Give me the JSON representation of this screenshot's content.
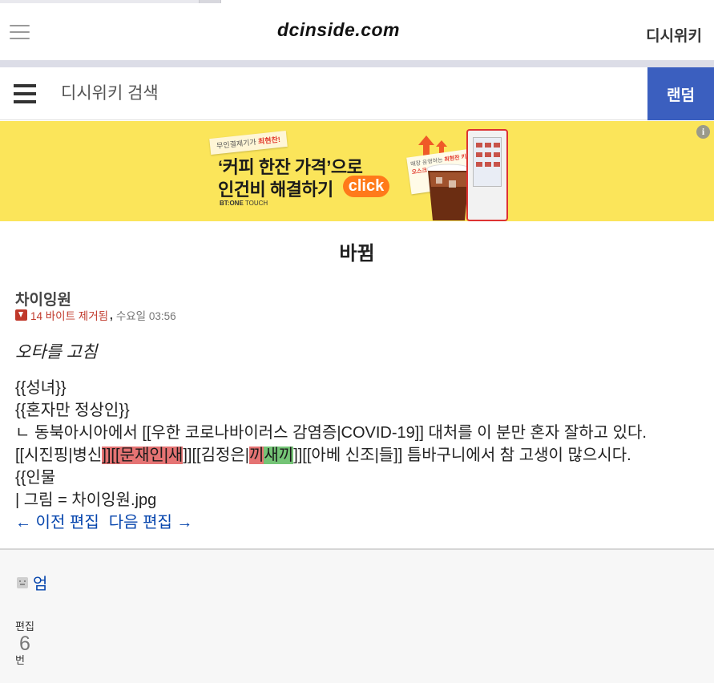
{
  "header": {
    "logo": "dcinside.com",
    "site_link": "디시위키"
  },
  "search": {
    "placeholder": "디시위키 검색",
    "random_label": "랜덤"
  },
  "ad": {
    "tag_prefix": "무인결제기가 ",
    "tag_highlight": "최현찬!",
    "line1": "‘커피 한잔 가격’으로",
    "line2": "인건비 해결하기",
    "click_label": "click",
    "brand_bold": "BT:ONE",
    "brand_rest": " TOUCH",
    "note_text": "매장 운영하는 ",
    "note_highlight": "최현찬 키오스크",
    "info_icon": "i"
  },
  "page": {
    "title": "바뀜"
  },
  "revision": {
    "author": "차이잉원",
    "bytes_removed": "14 바이트 제거됨",
    "comma": ",",
    "timestamp": "수요일 03:56",
    "summary": "오타를 고침"
  },
  "wikitext": {
    "line1": "{{성녀}}",
    "line2": "{{혼자만 정상인}}",
    "line3": "ㄴ 동북아시아에서 [[우한 코로나바이러스 감염증|COVID-19]] 대처를 이 분만 혼자 잘하고 있다.",
    "line4_a": "[[시진핑|병신",
    "line4_del1": "]][[문재인|새",
    "line4_b": "]][[김정은|",
    "line4_del2": "끼",
    "line4_ins": "새끼",
    "line4_c": "]][[아베 신조|들]] 틈바구니에서 참 고생이 많으시다.",
    "line5": "{{인물",
    "line6": "| 그림 = 차이잉원.jpg"
  },
  "nav": {
    "prev_label": "← 이전 편집",
    "next_label": "다음 편집 →"
  },
  "footer": {
    "user_name": "엄",
    "edit_label_top": "편집",
    "edit_count": "6",
    "edit_label_bottom": "번"
  }
}
